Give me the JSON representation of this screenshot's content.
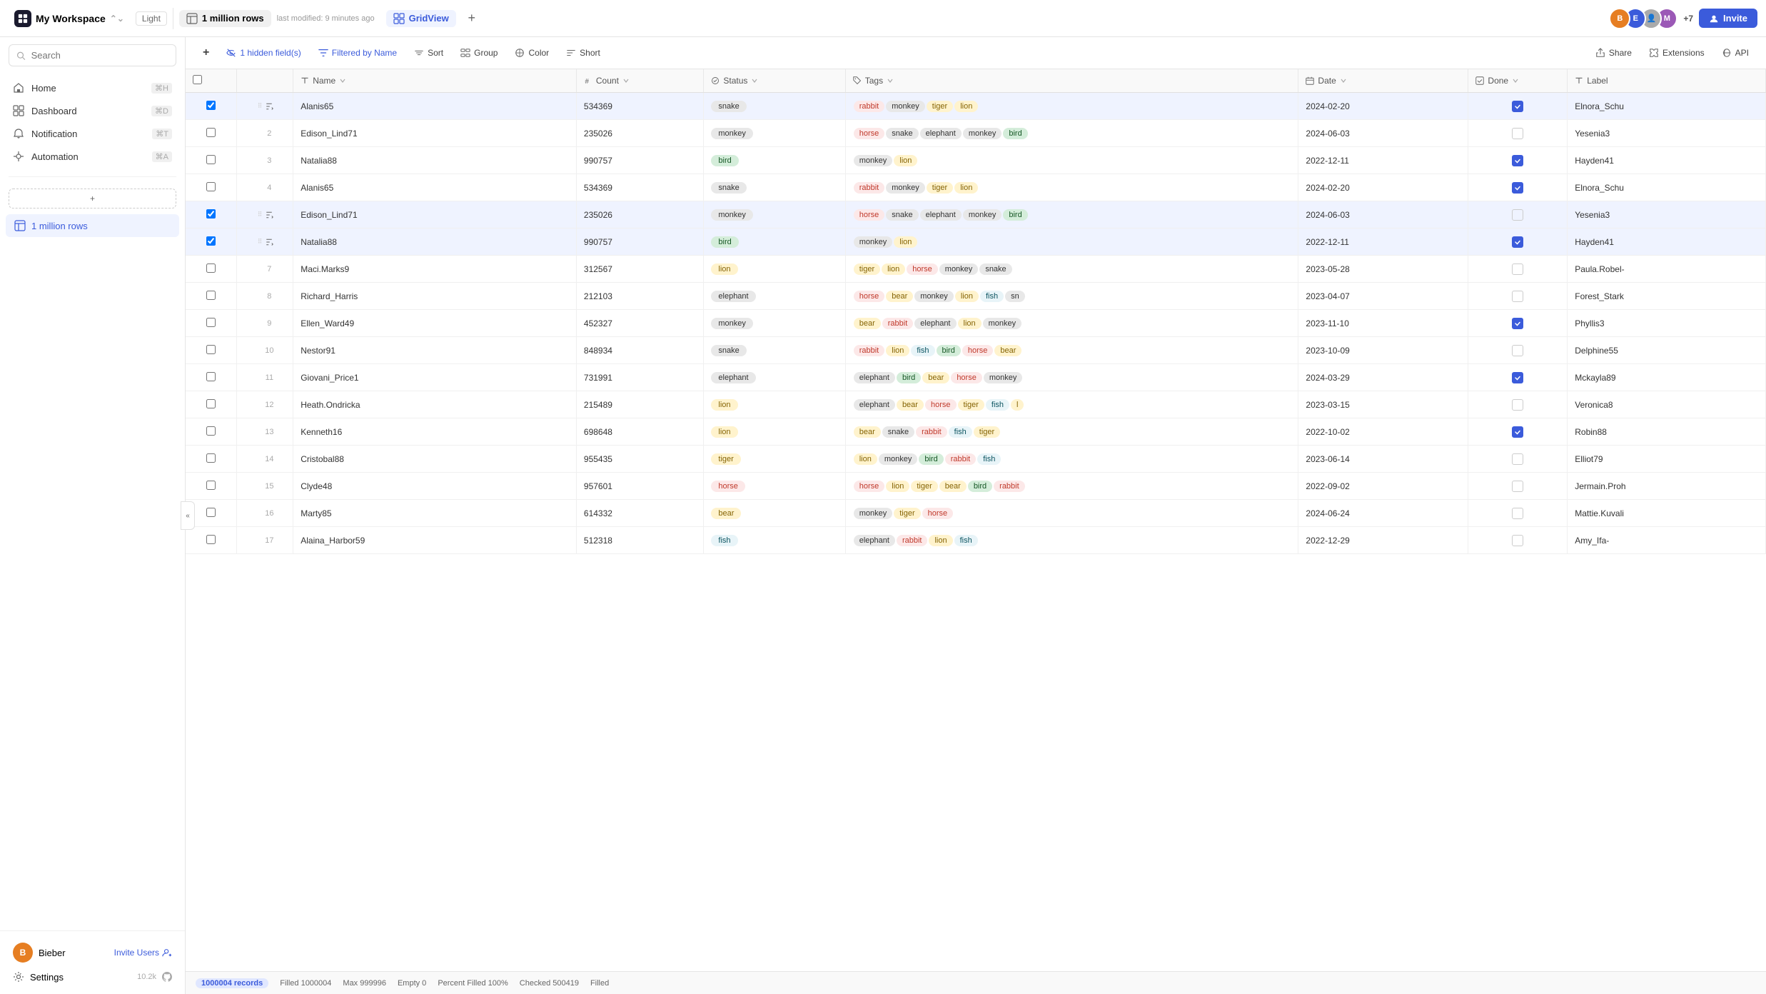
{
  "app": {
    "workspace": "My Workspace",
    "theme": "Light",
    "table": "1 million rows",
    "modified": "last modified: 9 minutes ago",
    "view": "GridView",
    "invite_label": "Invite"
  },
  "sidebar": {
    "search_placeholder": "Search",
    "nav": [
      {
        "id": "home",
        "label": "Home",
        "shortcut": "⌘H",
        "icon": "home"
      },
      {
        "id": "dashboard",
        "label": "Dashboard",
        "shortcut": "⌘D",
        "icon": "dashboard"
      },
      {
        "id": "notification",
        "label": "Notification",
        "shortcut": "⌘T",
        "icon": "bell"
      },
      {
        "id": "automation",
        "label": "Automation",
        "shortcut": "⌘A",
        "icon": "automation"
      }
    ],
    "table_name": "1 million rows",
    "user": {
      "name": "Bieber",
      "count": "10.2k"
    },
    "invite_users": "Invite Users",
    "settings": "Settings"
  },
  "toolbar": {
    "add": "+",
    "hidden_fields": "1 hidden field(s)",
    "filter": "Filtered by Name",
    "sort": "Sort",
    "group": "Group",
    "color": "Color",
    "short": "Short",
    "share": "Share",
    "extensions": "Extensions",
    "api": "API"
  },
  "columns": [
    {
      "id": "name",
      "label": "Name",
      "icon": "text"
    },
    {
      "id": "count",
      "label": "Count",
      "icon": "number"
    },
    {
      "id": "status",
      "label": "Status",
      "icon": "status"
    },
    {
      "id": "tags",
      "label": "Tags",
      "icon": "tags"
    },
    {
      "id": "date",
      "label": "Date",
      "icon": "calendar"
    },
    {
      "id": "done",
      "label": "Done",
      "icon": "check"
    },
    {
      "id": "label",
      "label": "Label",
      "icon": "text"
    }
  ],
  "rows": [
    {
      "id": 1,
      "name": "Alanis65",
      "count": "534369",
      "status": "snake",
      "tags": [
        "rabbit",
        "monkey",
        "tiger",
        "lion"
      ],
      "date": "2024-02-20",
      "done": true,
      "label": "Elnora_Schu",
      "selected": true
    },
    {
      "id": 2,
      "name": "Edison_Lind71",
      "count": "235026",
      "status": "monkey",
      "tags": [
        "horse",
        "snake",
        "elephant",
        "monkey",
        "bird"
      ],
      "date": "2024-06-03",
      "done": false,
      "label": "Yesenia3",
      "selected": false
    },
    {
      "id": 3,
      "name": "Natalia88",
      "count": "990757",
      "status": "bird",
      "tags": [
        "monkey",
        "lion"
      ],
      "date": "2022-12-11",
      "done": true,
      "label": "Hayden41",
      "selected": false
    },
    {
      "id": 4,
      "name": "Alanis65",
      "count": "534369",
      "status": "snake",
      "tags": [
        "rabbit",
        "monkey",
        "tiger",
        "lion"
      ],
      "date": "2024-02-20",
      "done": true,
      "label": "Elnora_Schu",
      "selected": false
    },
    {
      "id": 5,
      "name": "Edison_Lind71",
      "count": "235026",
      "status": "monkey",
      "tags": [
        "horse",
        "snake",
        "elephant",
        "monkey",
        "bird"
      ],
      "date": "2024-06-03",
      "done": false,
      "label": "Yesenia3",
      "selected": true
    },
    {
      "id": 6,
      "name": "Natalia88",
      "count": "990757",
      "status": "bird",
      "tags": [
        "monkey",
        "lion"
      ],
      "date": "2022-12-11",
      "done": true,
      "label": "Hayden41",
      "selected": true
    },
    {
      "id": 7,
      "name": "Maci.Marks9",
      "count": "312567",
      "status": "lion",
      "tags": [
        "tiger",
        "lion",
        "horse",
        "monkey",
        "snake"
      ],
      "date": "2023-05-28",
      "done": false,
      "label": "Paula.Robel-",
      "selected": false
    },
    {
      "id": 8,
      "name": "Richard_Harris",
      "count": "212103",
      "status": "elephant",
      "tags": [
        "horse",
        "bear",
        "monkey",
        "lion",
        "fish",
        "sn"
      ],
      "date": "2023-04-07",
      "done": false,
      "label": "Forest_Stark",
      "selected": false
    },
    {
      "id": 9,
      "name": "Ellen_Ward49",
      "count": "452327",
      "status": "monkey",
      "tags": [
        "bear",
        "rabbit",
        "elephant",
        "lion",
        "monkey"
      ],
      "date": "2023-11-10",
      "done": true,
      "label": "Phyllis3",
      "selected": false
    },
    {
      "id": 10,
      "name": "Nestor91",
      "count": "848934",
      "status": "snake",
      "tags": [
        "rabbit",
        "lion",
        "fish",
        "bird",
        "horse",
        "bear"
      ],
      "date": "2023-10-09",
      "done": false,
      "label": "Delphine55",
      "selected": false
    },
    {
      "id": 11,
      "name": "Giovani_Price1",
      "count": "731991",
      "status": "elephant",
      "tags": [
        "elephant",
        "bird",
        "bear",
        "horse",
        "monkey"
      ],
      "date": "2024-03-29",
      "done": true,
      "label": "Mckayla89",
      "selected": false
    },
    {
      "id": 12,
      "name": "Heath.Ondricka",
      "count": "215489",
      "status": "lion",
      "tags": [
        "elephant",
        "bear",
        "horse",
        "tiger",
        "fish",
        "l"
      ],
      "date": "2023-03-15",
      "done": false,
      "label": "Veronica8",
      "selected": false
    },
    {
      "id": 13,
      "name": "Kenneth16",
      "count": "698648",
      "status": "lion",
      "tags": [
        "bear",
        "snake",
        "rabbit",
        "fish",
        "tiger"
      ],
      "date": "2022-10-02",
      "done": true,
      "label": "Robin88",
      "selected": false
    },
    {
      "id": 14,
      "name": "Cristobal88",
      "count": "955435",
      "status": "tiger",
      "tags": [
        "lion",
        "monkey",
        "bird",
        "rabbit",
        "fish"
      ],
      "date": "2023-06-14",
      "done": false,
      "label": "Elliot79",
      "selected": false
    },
    {
      "id": 15,
      "name": "Clyde48",
      "count": "957601",
      "status": "horse",
      "tags": [
        "horse",
        "lion",
        "tiger",
        "bear",
        "bird",
        "rabbit"
      ],
      "date": "2022-09-02",
      "done": false,
      "label": "Jermain.Proh",
      "selected": false
    },
    {
      "id": 16,
      "name": "Marty85",
      "count": "614332",
      "status": "bear",
      "tags": [
        "monkey",
        "tiger",
        "horse"
      ],
      "date": "2024-06-24",
      "done": false,
      "label": "Mattie.Kuvali",
      "selected": false
    },
    {
      "id": 17,
      "name": "Alaina_Harbor59",
      "count": "512318",
      "status": "fish",
      "tags": [
        "elephant",
        "rabbit",
        "lion",
        "fish"
      ],
      "date": "2022-12-29",
      "done": false,
      "label": "Amy_Ifa-",
      "selected": false
    }
  ],
  "status_bar": {
    "records": "1000004 records",
    "filled": "Filled 1000004",
    "max": "Max 999996",
    "empty": "Empty 0",
    "percent": "Percent Filled 100%",
    "checked": "Checked 500419",
    "filled_label": "Filled"
  },
  "avatars": [
    {
      "color": "#e67e22"
    },
    {
      "color": "#3b5bdb"
    },
    {
      "color": "#2ecc71"
    },
    {
      "color": "#9b59b6"
    }
  ],
  "plus_count": "+7"
}
